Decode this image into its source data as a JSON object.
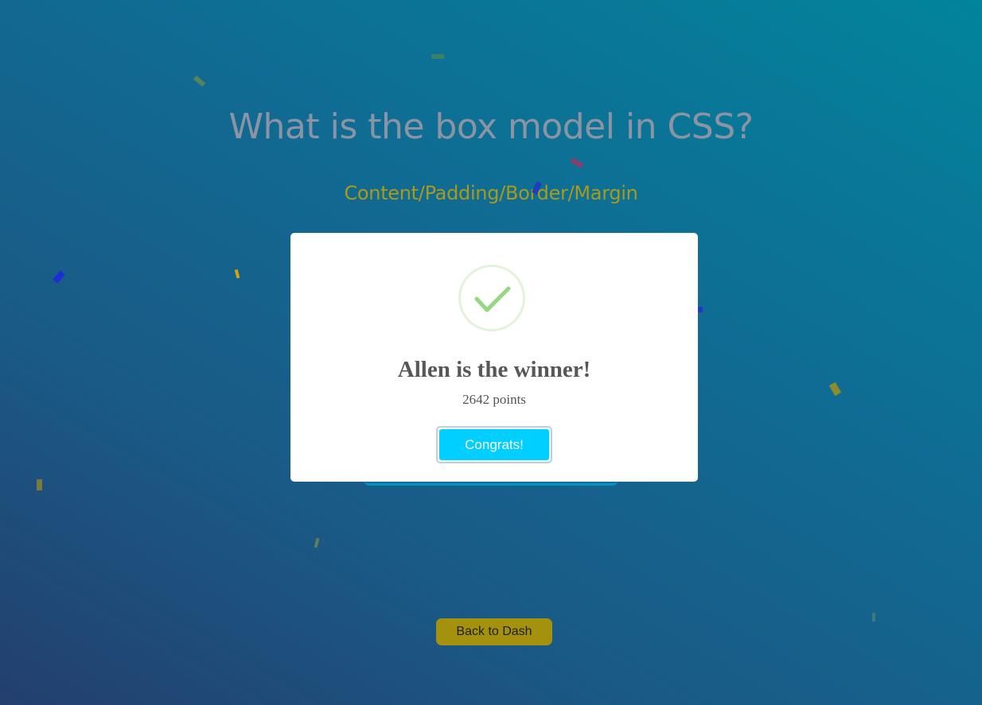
{
  "game": {
    "question": "What is the box model in CSS?",
    "answer": "Content/Padding/Border/Margin",
    "back_label": "Back to Dash"
  },
  "modal": {
    "icon": "check-icon",
    "title": "Allen is the winner!",
    "points": "2642 points",
    "button_label": "Congrats!"
  },
  "colors": {
    "accent_cyan": "#00cfff",
    "back_button": "#a4920f",
    "answer_text": "#a89a1c",
    "check_green": "#8fd27a"
  }
}
